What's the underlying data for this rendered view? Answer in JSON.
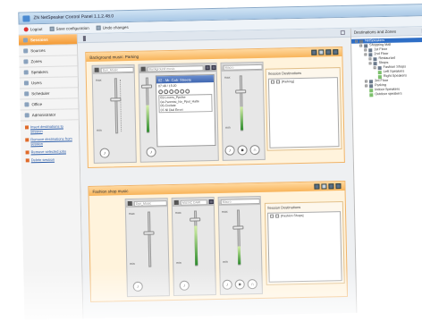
{
  "window": {
    "title": "ZN NetSpeaker Control Panel 1.1.2.48.0"
  },
  "toolbar": {
    "logout": "Logout",
    "save": "Save configuration",
    "undo": "Undo changes"
  },
  "sidebar": {
    "items": [
      {
        "label": "Sessions",
        "active": true
      },
      {
        "label": "Sources"
      },
      {
        "label": "Zones"
      },
      {
        "label": "Speakers"
      },
      {
        "label": "Users"
      },
      {
        "label": "Scheduler"
      },
      {
        "label": "Office"
      },
      {
        "label": "Administrator"
      }
    ],
    "tasks": [
      "Insert destinations to session",
      "Remove destinations from session",
      "Remove selected jobs",
      "Delete session"
    ]
  },
  "sessions": [
    {
      "title": "Background music: Parking",
      "sources": [
        {
          "name": "Dyn_Music"
        },
        {
          "name": "Background music"
        },
        {
          "name": "Macro"
        }
      ],
      "player": {
        "track": "02 - Mr. Cab: Streets",
        "time": "07:48 / 15:20",
        "playlist": [
          "03-Lovers_Ppulse",
          "04-Parentsi_No_Ppul_Halte",
          "05-Croilate",
          "07-Nl Dial Errori"
        ]
      },
      "dest_label": "Session Destinations",
      "dest_items": [
        "[Parking]"
      ]
    },
    {
      "title": "Fashion shop music",
      "sources": [
        {
          "name": "Dyn_Music"
        },
        {
          "name": "MUSIC DAW"
        },
        {
          "name": "Macro"
        }
      ],
      "dest_label": "Session Destinations",
      "dest_items": [
        "[Fashion Shops]"
      ]
    }
  ],
  "slider": {
    "max": "max",
    "min": "min"
  },
  "right": {
    "title": "Destinations and Zones",
    "tree": [
      {
        "label": "NetSpeakers",
        "depth": 0,
        "sel": true
      },
      {
        "label": "Shopping Mall",
        "depth": 1
      },
      {
        "label": "1st Floor",
        "depth": 2
      },
      {
        "label": "2nd Floor",
        "depth": 2
      },
      {
        "label": "Restaurant",
        "depth": 3
      },
      {
        "label": "Shops",
        "depth": 3
      },
      {
        "label": "Fashion Shops",
        "depth": 4
      },
      {
        "label": "Left Speakers",
        "depth": 5,
        "sp": true
      },
      {
        "label": "Right Speakers",
        "depth": 5,
        "sp": true
      },
      {
        "label": "3rd Floor",
        "depth": 2
      },
      {
        "label": "Parking",
        "depth": 2
      },
      {
        "label": "Indoor Speakers",
        "depth": 3,
        "sp": true
      },
      {
        "label": "Outdoor speakers",
        "depth": 3,
        "sp": true
      }
    ]
  }
}
